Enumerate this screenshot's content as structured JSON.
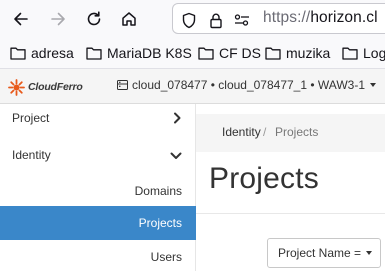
{
  "browser": {
    "url_scheme": "https://",
    "url_host": "horizon.cl"
  },
  "bookmarks": [
    {
      "label": "adresa"
    },
    {
      "label": "MariaDB K8S"
    },
    {
      "label": "CF DS"
    },
    {
      "label": "muzika"
    },
    {
      "label": "Log"
    }
  ],
  "header": {
    "logo_text": "CloudFerro",
    "context": "cloud_078477 • cloud_078477_1 • WAW3-1"
  },
  "sidebar": {
    "items": [
      {
        "label": "Project",
        "icon": "chevron-right-icon"
      },
      {
        "label": "Identity",
        "icon": "chevron-down-icon"
      },
      {
        "label": "Domains"
      },
      {
        "label": "Projects",
        "active": true
      },
      {
        "label": "Users"
      }
    ]
  },
  "main": {
    "breadcrumb": [
      "Identity",
      "Projects"
    ],
    "breadcrumb_separator": "/",
    "title": "Projects",
    "filter_label": "Project Name ="
  },
  "colors": {
    "active_bg": "#3a87c9",
    "logo_orange": "#e8591a"
  }
}
